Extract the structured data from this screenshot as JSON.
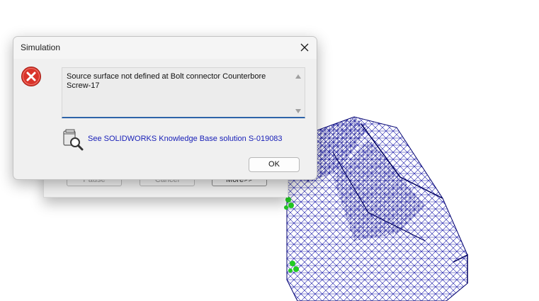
{
  "dialog": {
    "title": "Simulation",
    "message": "Source surface not defined at Bolt connector Counterbore\nScrew-17",
    "kb_link": "See SOLIDWORKS Knowledge Base solution S-019083",
    "ok_label": "OK"
  },
  "background_dialog": {
    "pause_label": "Pause",
    "cancel_label": "Cancel",
    "more_label": "More>>"
  },
  "icons": {
    "error": "error-icon",
    "close": "close-icon",
    "knowledge_base": "knowledge-base-search-icon"
  },
  "colors": {
    "mesh": "#1010a0",
    "error_red": "#d9342b",
    "link": "#1a21b8",
    "focus_underline": "#2e64a8",
    "markers": "#22cc22"
  }
}
